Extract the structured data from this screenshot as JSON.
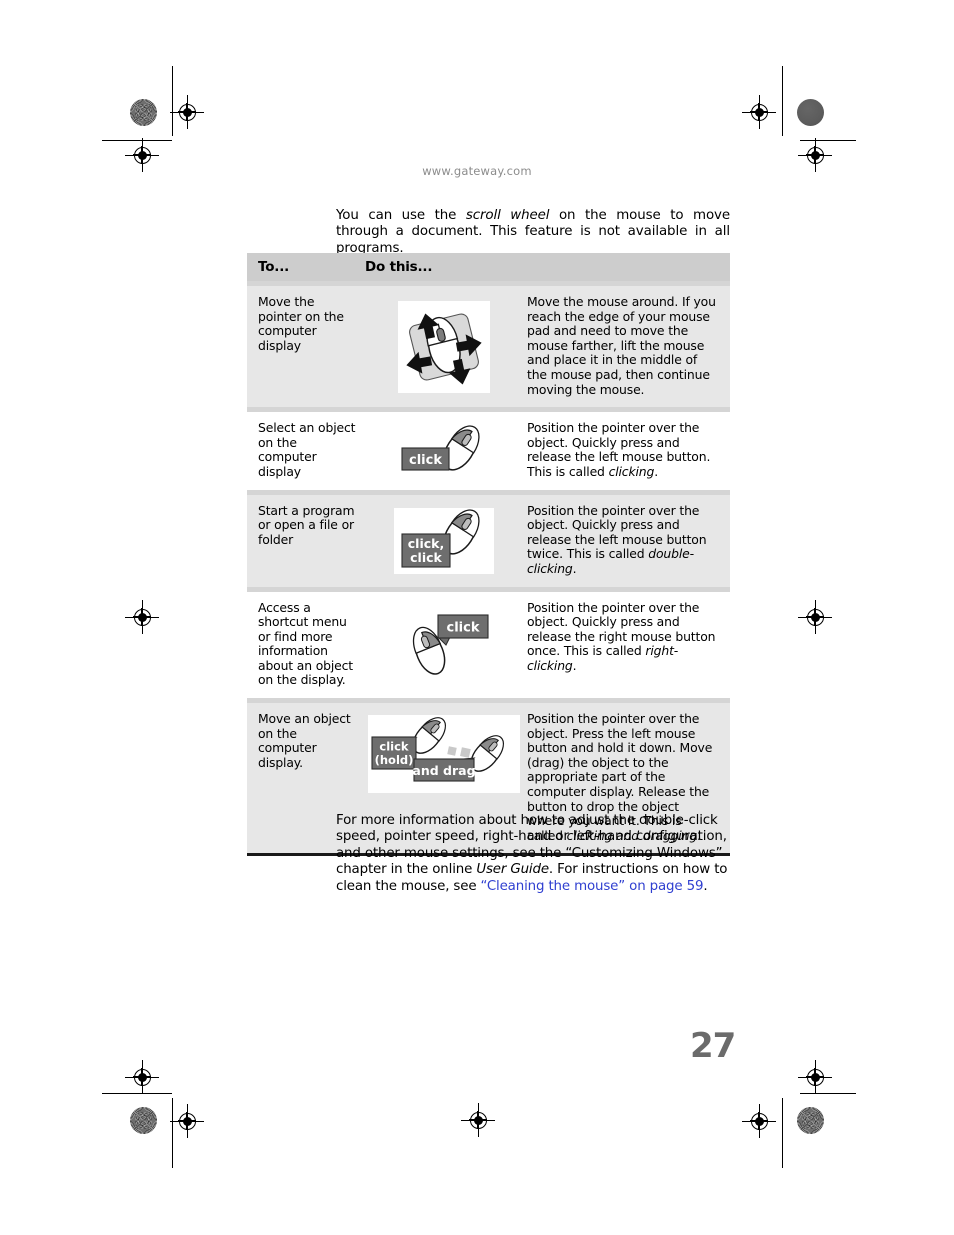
{
  "page": {
    "url_header": "www.gateway.com",
    "page_number": "27",
    "link_color": "#2f3fd0",
    "header_bg": "#cdcdcd",
    "row_shade_bg": "#e7e7e7"
  },
  "intro": {
    "part1": "You can use the ",
    "emphasis": "scroll wheel",
    "part2": " on the mouse to move through a document. This feature is not available in all programs."
  },
  "table": {
    "headers": {
      "col_to": "To...",
      "col_do": "Do this..."
    },
    "rows": [
      {
        "to": "Move the pointer on the computer display",
        "art": "mouse-on-pad-with-arrows",
        "art_labels": [],
        "do_text": "Move the mouse around. If you reach the edge of your mouse pad and need to move the mouse farther, lift the mouse and place it in the middle of the mouse pad, then continue moving the mouse.",
        "do_emphasis": "",
        "do_tail": ""
      },
      {
        "to": "Select an object on the computer display",
        "art": "mouse-left-click",
        "art_labels": [
          "click"
        ],
        "do_text": "Position the pointer over the object. Quickly press and release the left mouse button. This is called ",
        "do_emphasis": "clicking",
        "do_tail": "."
      },
      {
        "to": "Start a program or open a file or folder",
        "art": "mouse-double-click",
        "art_labels": [
          "click,",
          "click"
        ],
        "do_text": "Position the pointer over the object. Quickly press and release the left mouse button twice. This is called ",
        "do_emphasis": "double-clicking",
        "do_tail": "."
      },
      {
        "to": "Access a shortcut menu or find more information about an object on the display.",
        "art": "mouse-right-click",
        "art_labels": [
          "click"
        ],
        "do_text": "Position the pointer over the object. Quickly press and release the right mouse button once. This is called ",
        "do_emphasis": "right-clicking",
        "do_tail": "."
      },
      {
        "to": "Move an object on the computer display.",
        "art": "mouse-click-and-drag",
        "art_labels": [
          "click",
          "(hold)",
          "and drag"
        ],
        "do_text": "Position the pointer over the object. Press the left mouse button and hold it down. Move (drag) the object to the appropriate part of the computer display. Release the button to drop the object where you want it. This is called ",
        "do_emphasis": "clicking and dragging",
        "do_tail": "."
      }
    ]
  },
  "closing": {
    "part1": "For more information about how to adjust the double-click speed, pointer speed, right-hand or left-hand configuration, and other mouse settings, see the “Customizing Windows” chapter in the online ",
    "emphasis": "User Guide",
    "part2": ". For instructions on how to clean the mouse, see ",
    "link": "“Cleaning the mouse” on page 59",
    "part3": "."
  }
}
